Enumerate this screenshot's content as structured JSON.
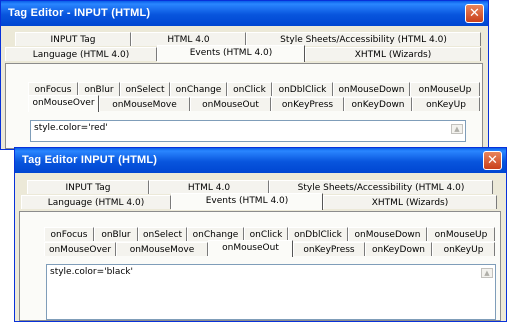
{
  "window1": {
    "title": "Tag Editor - INPUT   (HTML)",
    "close_glyph": "✕",
    "tabs_row1": [
      "INPUT Tag",
      "HTML 4.0",
      "Style Sheets/Accessibility (HTML 4.0)"
    ],
    "tabs_row2": [
      "Language (HTML 4.0)",
      "Events (HTML 4.0)",
      "XHTML (Wizards)"
    ],
    "events_row1": [
      "onFocus",
      "onBlur",
      "onSelect",
      "onChange",
      "onClick",
      "onDblClick",
      "onMouseDown",
      "onMouseUp"
    ],
    "events_row2": [
      "onMouseOver",
      "onMouseMove",
      "onMouseOut",
      "onKeyPress",
      "onKeyDown",
      "onKeyUp"
    ],
    "editor_value": "style.color='red'"
  },
  "window2": {
    "title": "Tag Editor   INPUT   (HTML)",
    "close_glyph": "✕",
    "tabs_row1": [
      "INPUT Tag",
      "HTML 4.0",
      "Style Sheets/Accessibility (HTML 4.0)"
    ],
    "tabs_row2": [
      "Language (HTML 4.0)",
      "Events (HTML 4.0)",
      "XHTML (Wizards)"
    ],
    "events_row1": [
      "onFocus",
      "onBlur",
      "onSelect",
      "onChange",
      "onClick",
      "onDblClick",
      "onMouseDown",
      "onMouseUp"
    ],
    "events_row2": [
      "onMouseOver",
      "onMouseMove",
      "onMouseOut",
      "onKeyPress",
      "onKeyDown",
      "onKeyUp"
    ],
    "editor_value": "style.color='black'"
  },
  "colors": {
    "titlebar": "#0a5ee8",
    "close_button": "#d9572d",
    "window_face": "#ece9d8"
  }
}
